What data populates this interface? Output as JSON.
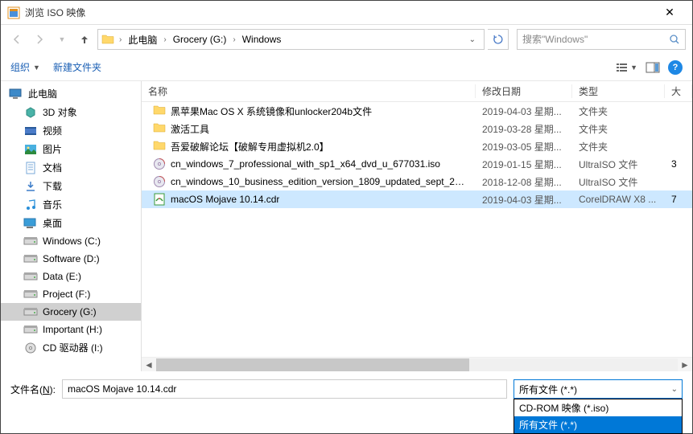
{
  "title": "浏览 ISO 映像",
  "breadcrumb": {
    "root_sep": "›",
    "items": [
      "此电脑",
      "Grocery (G:)",
      "Windows"
    ]
  },
  "search": {
    "placeholder": "搜索\"Windows\""
  },
  "toolbar": {
    "organize": "组织",
    "new_folder": "新建文件夹"
  },
  "sidebar": {
    "items": [
      {
        "label": "此电脑",
        "icon": "pc"
      },
      {
        "label": "3D 对象",
        "icon": "3d"
      },
      {
        "label": "视频",
        "icon": "video"
      },
      {
        "label": "图片",
        "icon": "picture"
      },
      {
        "label": "文档",
        "icon": "doc"
      },
      {
        "label": "下载",
        "icon": "download"
      },
      {
        "label": "音乐",
        "icon": "music"
      },
      {
        "label": "桌面",
        "icon": "desktop"
      },
      {
        "label": "Windows (C:)",
        "icon": "drive"
      },
      {
        "label": "Software (D:)",
        "icon": "drive"
      },
      {
        "label": "Data (E:)",
        "icon": "drive"
      },
      {
        "label": "Project (F:)",
        "icon": "drive"
      },
      {
        "label": "Grocery (G:)",
        "icon": "drive",
        "selected": true
      },
      {
        "label": "Important (H:)",
        "icon": "drive"
      },
      {
        "label": "CD 驱动器 (I:)",
        "icon": "cd"
      }
    ]
  },
  "columns": {
    "name": "名称",
    "date": "修改日期",
    "type": "类型",
    "size": "大"
  },
  "files": [
    {
      "name": "黑苹果Mac OS X 系统镜像和unlocker204b文件",
      "date": "2019-04-03 星期...",
      "type": "文件夹",
      "icon": "folder"
    },
    {
      "name": "激活工具",
      "date": "2019-03-28 星期...",
      "type": "文件夹",
      "icon": "folder"
    },
    {
      "name": "吾爱破解论坛【破解专用虚拟机2.0】",
      "date": "2019-03-05 星期...",
      "type": "文件夹",
      "icon": "folder"
    },
    {
      "name": "cn_windows_7_professional_with_sp1_x64_dvd_u_677031.iso",
      "date": "2019-01-15 星期...",
      "type": "UltraISO 文件",
      "size": "3",
      "icon": "iso"
    },
    {
      "name": "cn_windows_10_business_edition_version_1809_updated_sept_201...",
      "date": "2018-12-08 星期...",
      "type": "UltraISO 文件",
      "icon": "iso"
    },
    {
      "name": "macOS Mojave 10.14.cdr",
      "date": "2019-04-03 星期...",
      "type": "CorelDRAW X8 ...",
      "size": "7",
      "icon": "cdr",
      "selected": true
    }
  ],
  "filename": {
    "label_prefix": "文件名(",
    "label_key": "N",
    "label_suffix": "):",
    "value": "macOS Mojave 10.14.cdr"
  },
  "filter": {
    "selected": "所有文件 (*.*)",
    "options": [
      "CD-ROM 映像 (*.iso)",
      "所有文件 (*.*)"
    ],
    "highlight_index": 1
  }
}
